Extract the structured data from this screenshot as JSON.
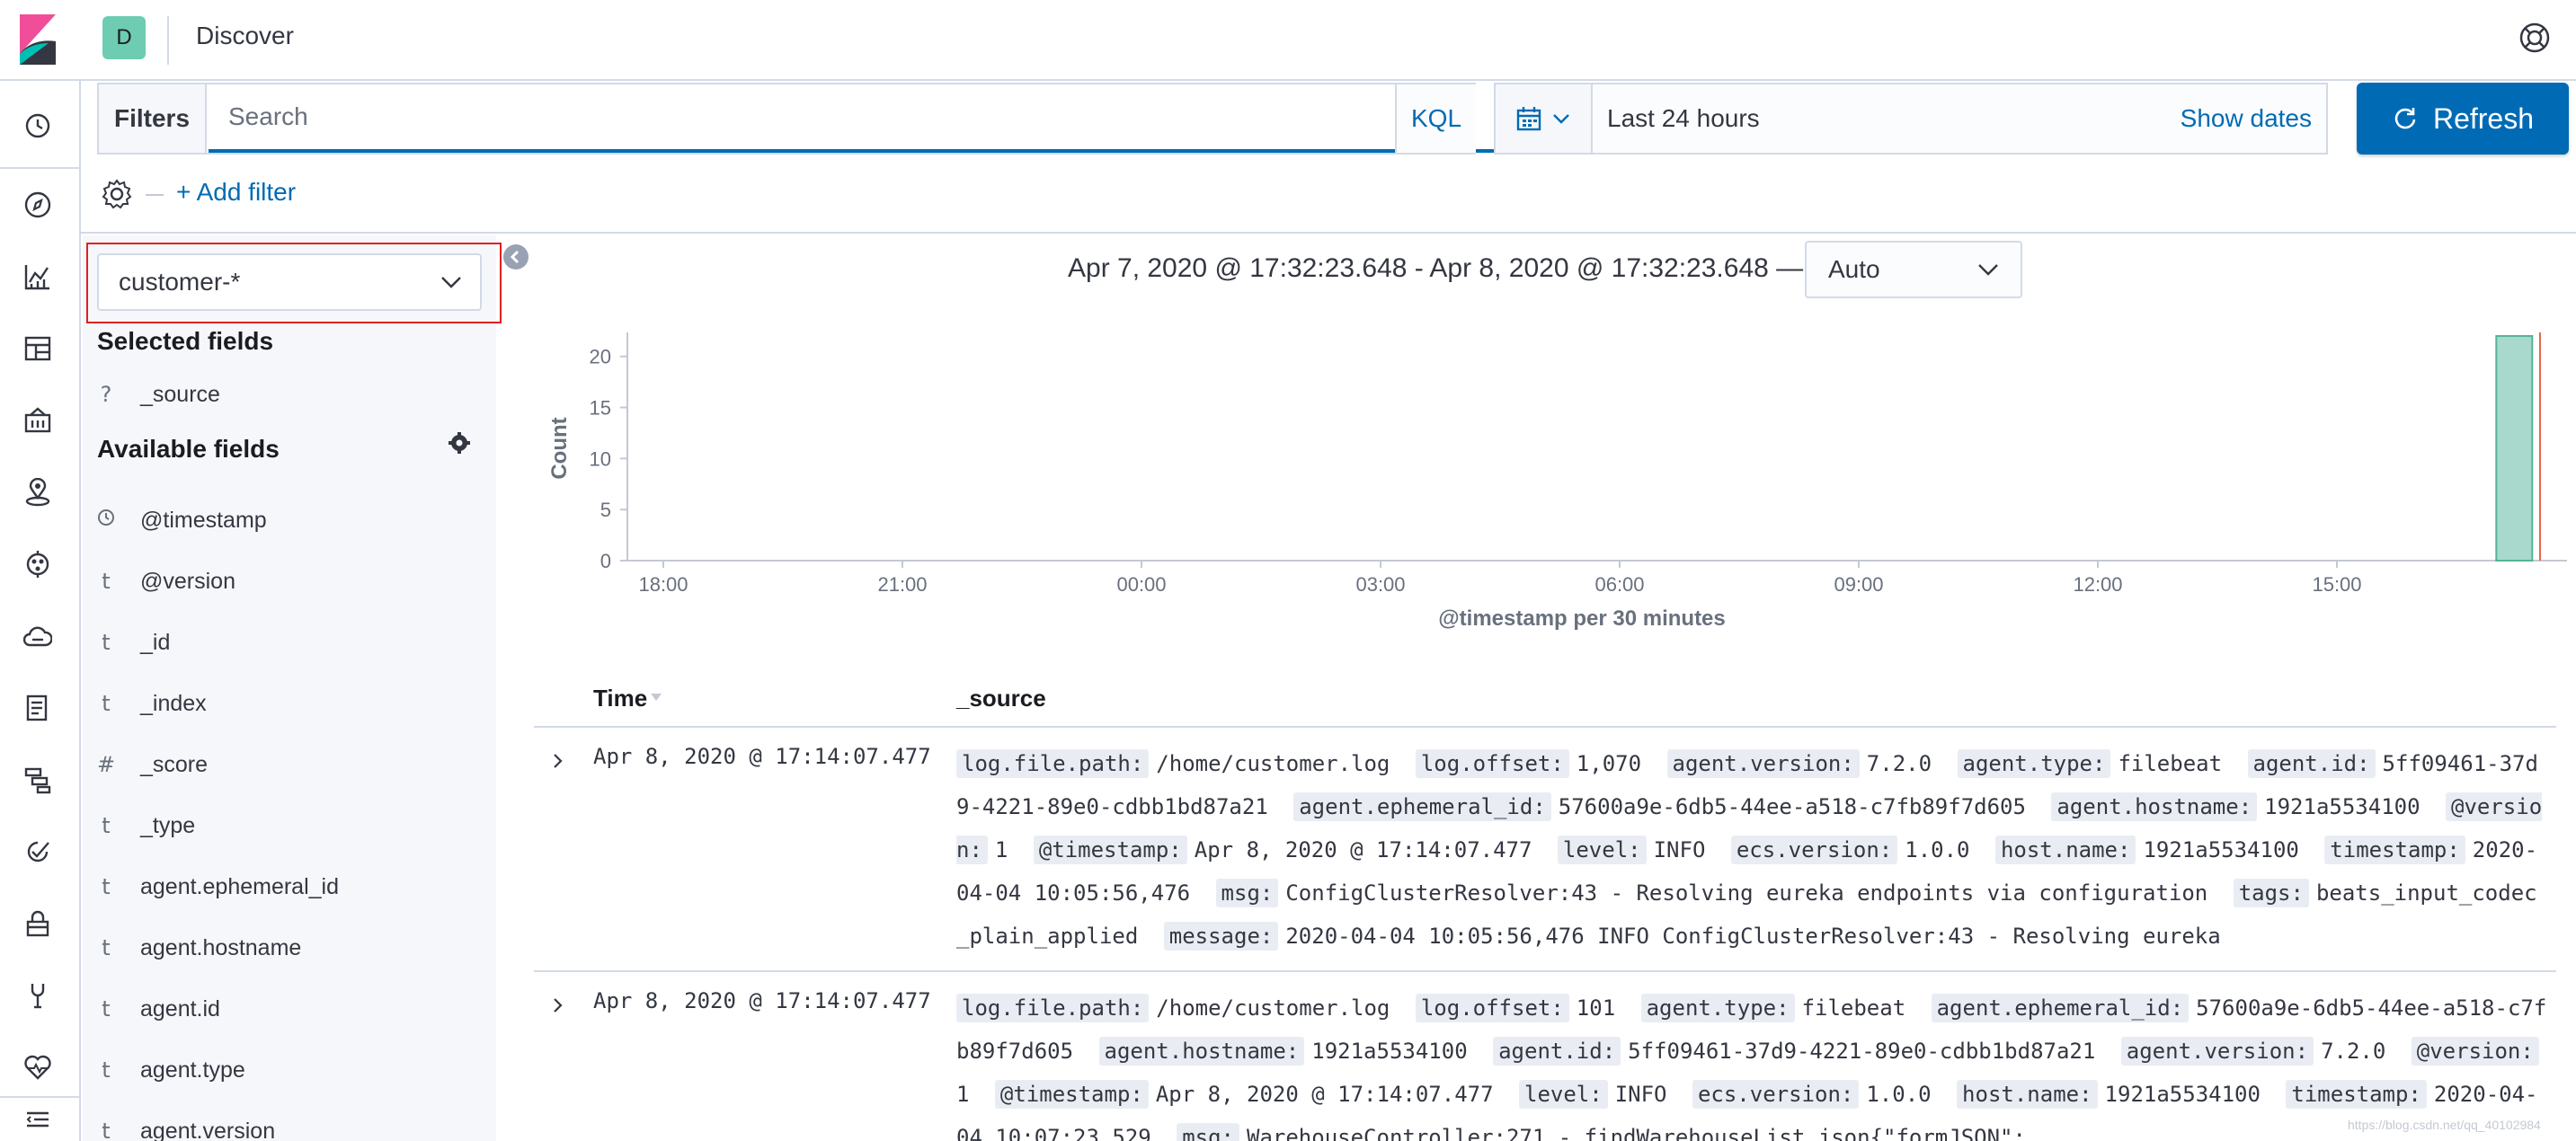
{
  "header": {
    "space_initial": "D",
    "app_title": "Discover"
  },
  "query": {
    "filters_label": "Filters",
    "search_placeholder": "Search",
    "language": "KQL"
  },
  "time": {
    "range": "Last 24 hours",
    "show_dates": "Show dates",
    "refresh_label": "Refresh"
  },
  "filter_bar": {
    "add_filter": "+ Add filter"
  },
  "sidebar": {
    "index_pattern": "customer-*",
    "selected_heading": "Selected fields",
    "selected_fields": [
      {
        "type": "?",
        "name": "_source"
      }
    ],
    "available_heading": "Available fields",
    "available_fields": [
      {
        "type": "clock",
        "name": "@timestamp"
      },
      {
        "type": "t",
        "name": "@version"
      },
      {
        "type": "t",
        "name": "_id"
      },
      {
        "type": "t",
        "name": "_index"
      },
      {
        "type": "#",
        "name": "_score"
      },
      {
        "type": "t",
        "name": "_type"
      },
      {
        "type": "t",
        "name": "agent.ephemeral_id"
      },
      {
        "type": "t",
        "name": "agent.hostname"
      },
      {
        "type": "t",
        "name": "agent.id"
      },
      {
        "type": "t",
        "name": "agent.type"
      },
      {
        "type": "t",
        "name": "agent.version"
      }
    ]
  },
  "chart_header": {
    "range_text": "Apr 7, 2020 @ 17:32:23.648 - Apr 8, 2020 @ 17:32:23.648 —",
    "interval": "Auto"
  },
  "chart_data": {
    "type": "bar",
    "xlabel": "@timestamp per 30 minutes",
    "ylabel": "Count",
    "ylim": [
      0,
      22
    ],
    "y_ticks": [
      "0",
      "5",
      "10",
      "15",
      "20"
    ],
    "x_ticks": [
      "18:00",
      "21:00",
      "00:00",
      "03:00",
      "06:00",
      "09:00",
      "12:00",
      "15:00"
    ],
    "bars": [
      {
        "x": "17:00",
        "value": 22
      }
    ],
    "grid": false,
    "bar_color": "#54b399"
  },
  "table": {
    "col_time": "Time",
    "col_source": "_source",
    "rows": [
      {
        "time": "Apr 8, 2020 @ 17:14:07.477",
        "fields": [
          [
            "log.file.path:",
            "/home/customer.log"
          ],
          [
            "log.offset:",
            "1,070"
          ],
          [
            "agent.version:",
            "7.2.0"
          ],
          [
            "agent.type:",
            "filebeat"
          ],
          [
            "agent.id:",
            "5ff09461-37d9-4221-89e0-cdbb1bd87a21"
          ],
          [
            "agent.ephemeral_id:",
            "57600a9e-6db5-44ee-a518-c7fb89f7d605"
          ],
          [
            "agent.hostname:",
            "1921a5534100"
          ],
          [
            "@version:",
            "1"
          ],
          [
            "@timestamp:",
            "Apr 8, 2020 @ 17:14:07.477"
          ],
          [
            "level:",
            "INFO"
          ],
          [
            "ecs.version:",
            "1.0.0"
          ],
          [
            "host.name:",
            "1921a5534100"
          ],
          [
            "timestamp:",
            "2020-04-04 10:05:56,476"
          ],
          [
            "msg:",
            "ConfigClusterResolver:43 - Resolving eureka endpoints via configuration"
          ],
          [
            "tags:",
            "beats_input_codec_plain_applied"
          ],
          [
            "message:",
            "2020-04-04 10:05:56,476 INFO ConfigClusterResolver:43 - Resolving eureka"
          ]
        ]
      },
      {
        "time": "Apr 8, 2020 @ 17:14:07.477",
        "fields": [
          [
            "log.file.path:",
            "/home/customer.log"
          ],
          [
            "log.offset:",
            "101"
          ],
          [
            "agent.type:",
            "filebeat"
          ],
          [
            "agent.ephemeral_id:",
            "57600a9e-6db5-44ee-a518-c7fb89f7d605"
          ],
          [
            "agent.hostname:",
            "1921a5534100"
          ],
          [
            "agent.id:",
            "5ff09461-37d9-4221-89e0-cdbb1bd87a21"
          ],
          [
            "agent.version:",
            "7.2.0"
          ],
          [
            "@version:",
            "1"
          ],
          [
            "@timestamp:",
            "Apr 8, 2020 @ 17:14:07.477"
          ],
          [
            "level:",
            "INFO"
          ],
          [
            "ecs.version:",
            "1.0.0"
          ],
          [
            "host.name:",
            "1921a5534100"
          ],
          [
            "timestamp:",
            "2020-04-04 10:07:23,529"
          ],
          [
            "msg:",
            "WarehouseController:271 - findWarehouseList.json{\"formJSON\":"
          ]
        ]
      }
    ]
  },
  "watermark": "https://blog.csdn.net/qq_40102984"
}
